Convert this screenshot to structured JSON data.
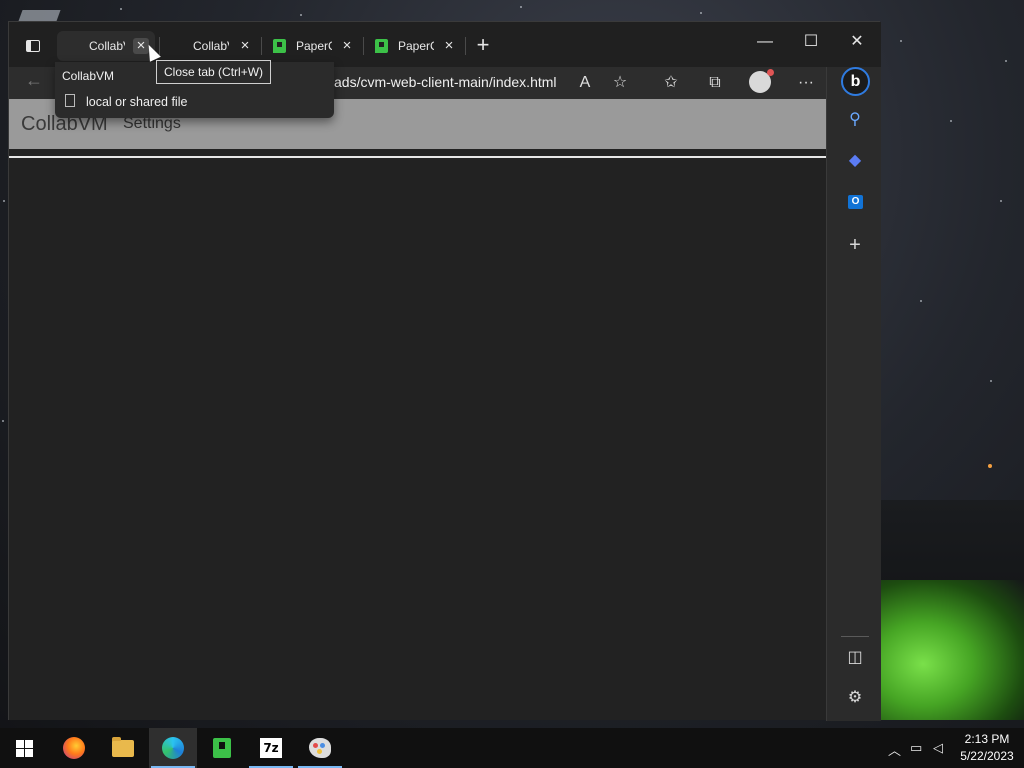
{
  "browser": {
    "tabs": [
      {
        "label": "CollabVM",
        "icon": "page-icon",
        "active": true
      },
      {
        "label": "CollabVM",
        "icon": "page-icon",
        "active": false
      },
      {
        "label": "PaperCut",
        "icon": "paper-icon",
        "active": false
      },
      {
        "label": "PaperCut",
        "icon": "paper-icon",
        "active": false
      }
    ],
    "new_tab": "+",
    "window_controls": {
      "minimize": "—",
      "maximize": "☐",
      "close": "✕"
    },
    "address_bar": {
      "url_visible": "ads/cvm-web-client-main/index.html"
    },
    "toolbar_icons": [
      "read-aloud-icon",
      "add-favorite-icon",
      "favorites-icon",
      "collections-icon",
      "profile-icon",
      "more-icon"
    ],
    "more": "···"
  },
  "hover_card": {
    "title": "CollabVM",
    "subtitle": "local or shared file",
    "tooltip": "Close tab (Ctrl+W)"
  },
  "page": {
    "brand": "CollabVM",
    "nav_settings": "Settings"
  },
  "sidebar": {
    "icons": [
      "bing-icon",
      "search-icon",
      "games-icon",
      "outlook-icon",
      "add-icon",
      "sidebar-toggle-icon",
      "settings-icon"
    ],
    "bing_label": "b",
    "outlook_label": "O"
  },
  "taskbar": {
    "apps": [
      "start",
      "firefox",
      "file-explorer",
      "edge",
      "notepad-plus",
      "7zip",
      "paint"
    ],
    "sevenzip_label": "7z",
    "clock": {
      "time": "2:13 PM",
      "date": "5/22/2023"
    }
  },
  "colors": {
    "accent": "#79b8f3",
    "navbar": "#9a9a9a",
    "page_bg": "#222222"
  }
}
